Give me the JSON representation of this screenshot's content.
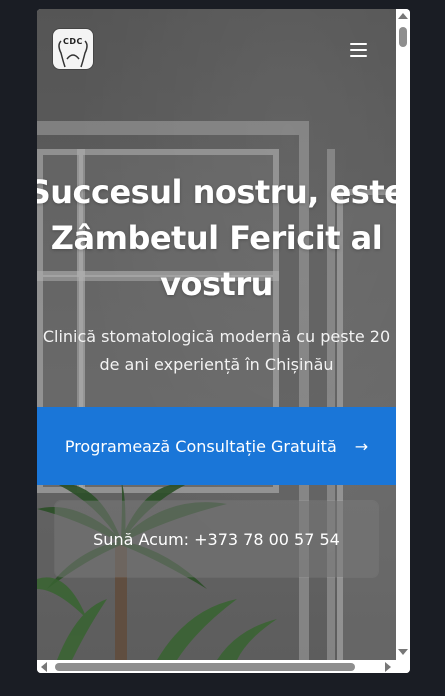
{
  "header": {
    "logo_text": "CDC",
    "menu_icon": "hamburger-menu-icon"
  },
  "hero": {
    "title_line1": "Succesul nostru, este",
    "title_line2": "Zâmbetul Fericit al",
    "title_line3": "vostru",
    "subtitle_line1": "Clinică stomatologică modernă cu peste 20",
    "subtitle_line2": "de ani experiență în Chișinău"
  },
  "buttons": {
    "primary_label": "Programează Consultație Gratuită",
    "primary_arrow": "→",
    "secondary_label": "Sună Acum: +373 78 00 57 54"
  },
  "colors": {
    "primary_button": "#1a76d8",
    "page_background": "#1a1d24"
  }
}
